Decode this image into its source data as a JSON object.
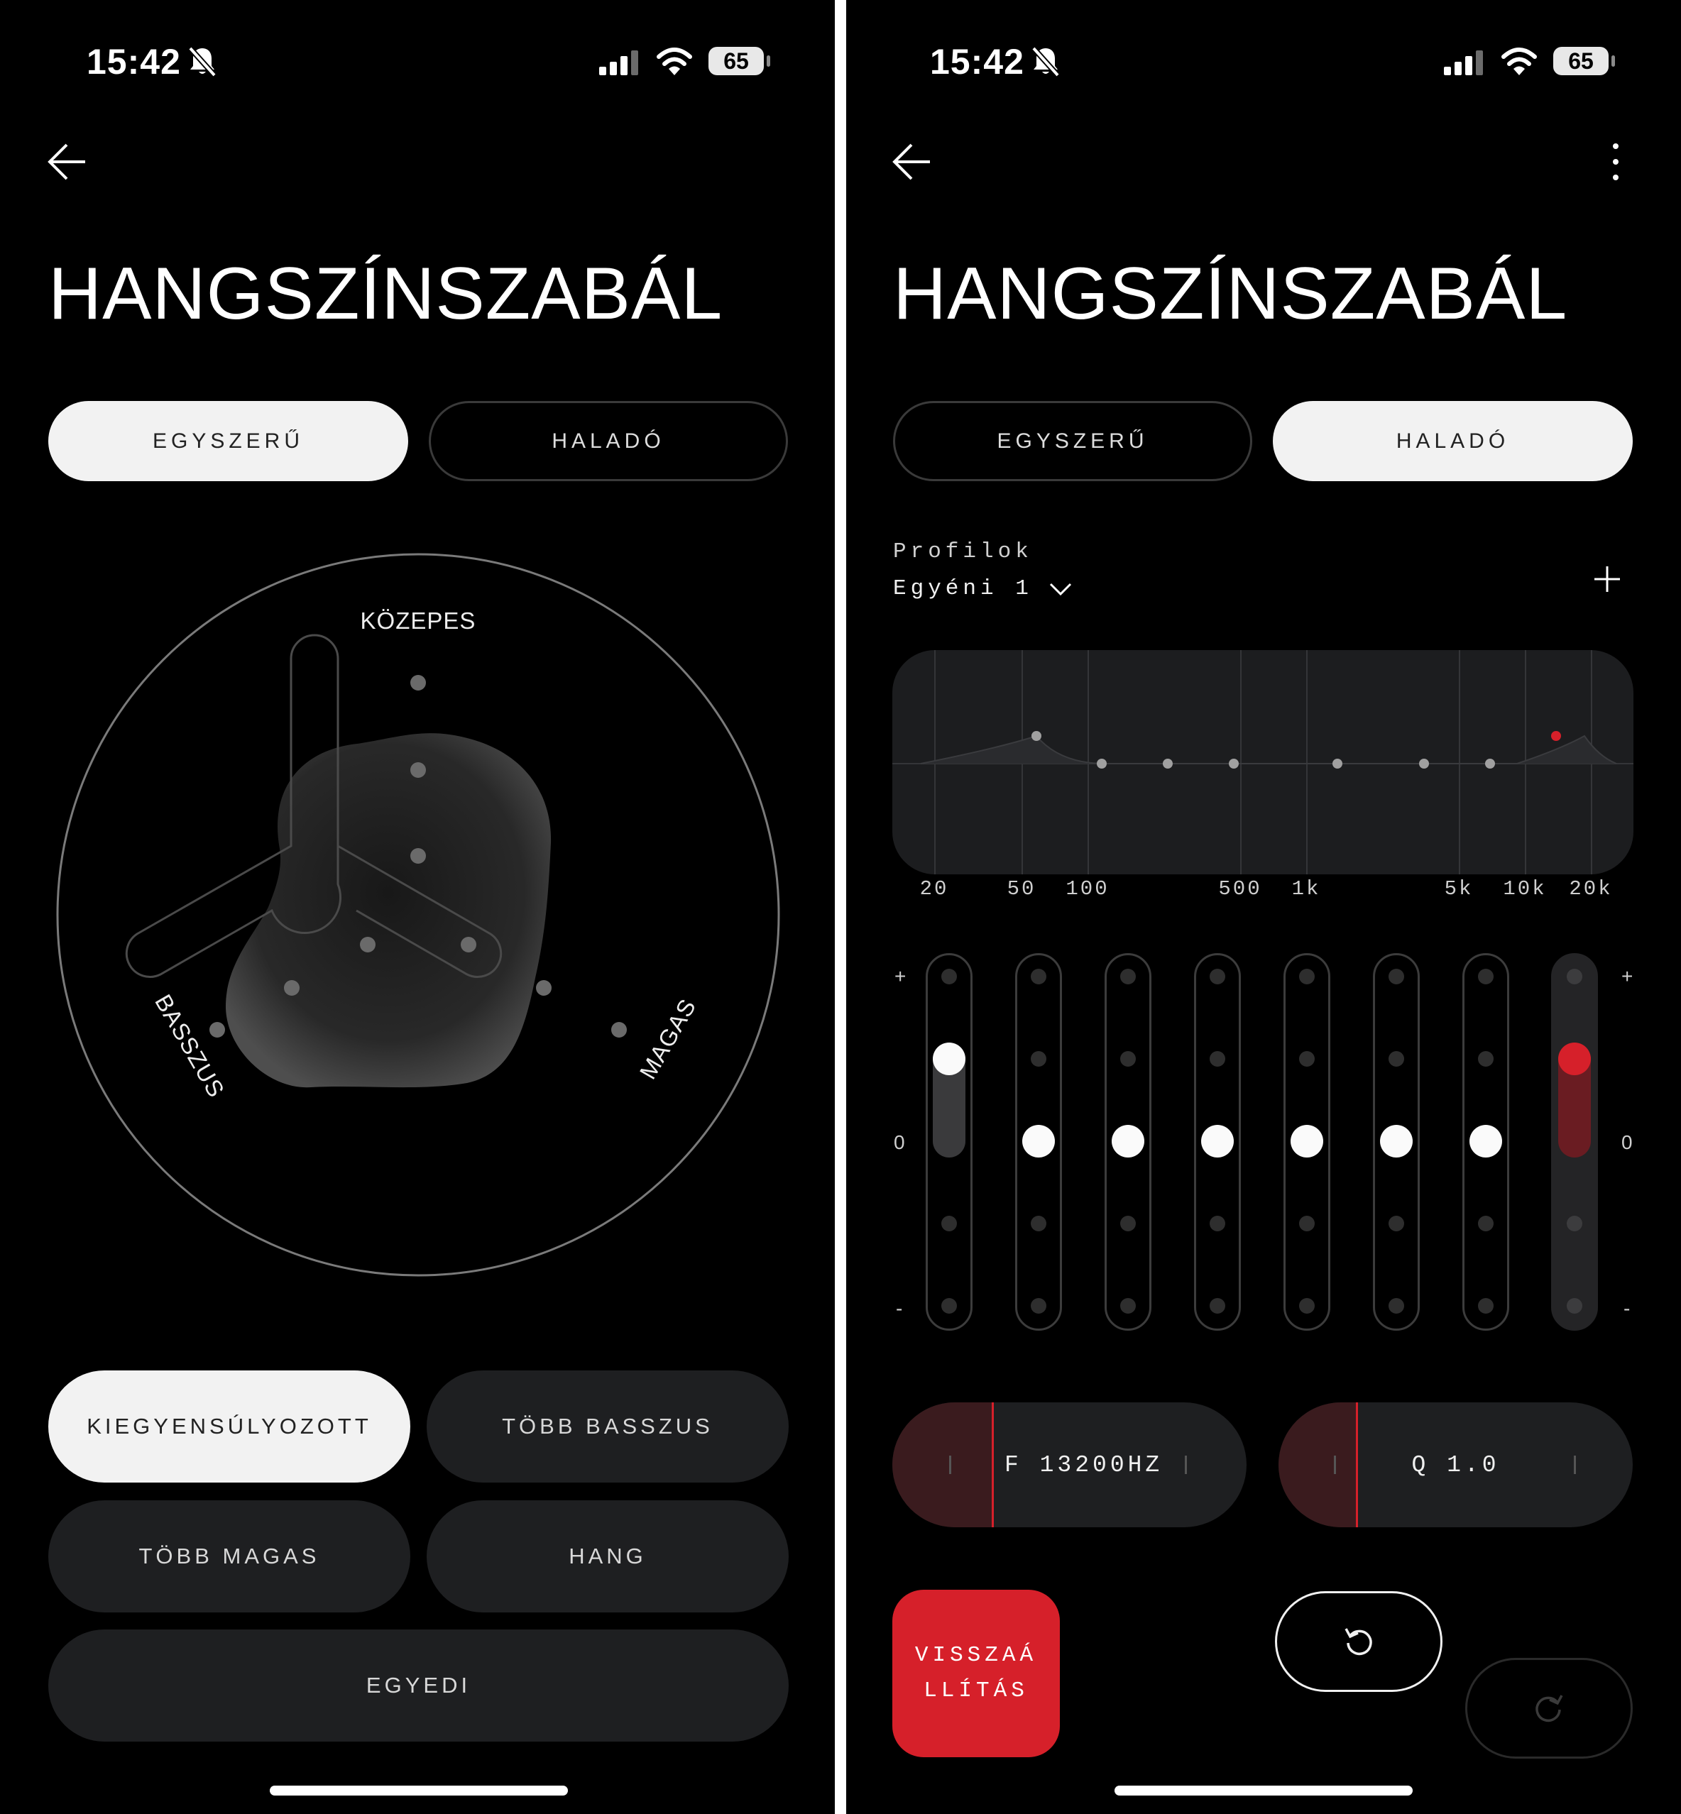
{
  "status_bar": {
    "time": "15:42",
    "battery": "65"
  },
  "simple_screen": {
    "title": "HANGSZÍNSZABÁL",
    "tabs": [
      "EGYSZERŰ",
      "HALADÓ"
    ],
    "active_tab": 0,
    "dial": {
      "top_label": "KÖZEPES",
      "left_label": "BASSZUS",
      "right_label": "MAGAS"
    },
    "presets": {
      "balanced": "KIEGYENSÚLYOZOTT",
      "more_bass": "TÖBB BASSZUS",
      "more_treble": "TÖBB MAGAS",
      "voice": "HANG",
      "custom": "EGYEDI"
    },
    "active_preset": "KIEGYENSÚLYOZOTT"
  },
  "advanced_screen": {
    "title": "HANGSZÍNSZABÁL",
    "tabs": [
      "EGYSZERŰ",
      "HALADÓ"
    ],
    "active_tab": 1,
    "profiles_label": "Profilok",
    "profile_name": "Egyéni 1",
    "freq_axis_labels": [
      "20",
      "50",
      "100",
      "500",
      "1k",
      "5k",
      "10k",
      "20k"
    ],
    "slider_scale": {
      "plus": "+",
      "zero": "0",
      "minus": "-"
    },
    "band_levels": [
      0.5,
      0,
      0,
      0,
      0,
      0,
      0,
      0.5
    ],
    "selected_band": 7,
    "frequency_control": "F  13200HZ",
    "q_control": "Q  1.0",
    "reset_button": "VISSZAÁ LLÍTÁS",
    "accent_color": "#d6202a"
  }
}
